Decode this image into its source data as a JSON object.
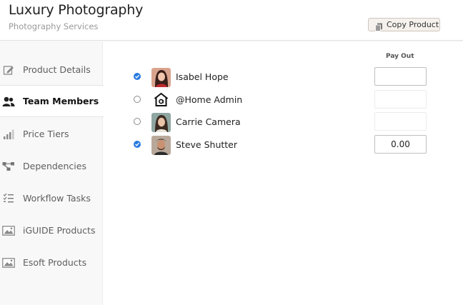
{
  "header": {
    "title": "Luxury Photography",
    "subtitle": "Photography Services",
    "copy_button": "Copy Product"
  },
  "sidebar": {
    "items": [
      {
        "label": "Product Details",
        "icon": "pencil-icon",
        "active": false
      },
      {
        "label": "Team Members",
        "icon": "users-icon",
        "active": true
      },
      {
        "label": "Price Tiers",
        "icon": "signal-bars-icon",
        "active": false
      },
      {
        "label": "Dependencies",
        "icon": "flow-icon",
        "active": false
      },
      {
        "label": "Workflow Tasks",
        "icon": "checklist-icon",
        "active": false
      },
      {
        "label": "iGUIDE Products",
        "icon": "image-icon",
        "active": false
      },
      {
        "label": "Esoft Products",
        "icon": "image-icon",
        "active": false
      }
    ]
  },
  "team": {
    "payout_header": "Pay Out",
    "members": [
      {
        "name": "Isabel Hope",
        "checked": true,
        "payout": "",
        "payout_enabled": true,
        "avatar": "photo-avatar"
      },
      {
        "name": "@Home Admin",
        "checked": false,
        "payout": "",
        "payout_enabled": false,
        "avatar": "home-logo-icon"
      },
      {
        "name": "Carrie Camera",
        "checked": false,
        "payout": "",
        "payout_enabled": false,
        "avatar": "photo-avatar"
      },
      {
        "name": "Steve Shutter",
        "checked": true,
        "payout": "0.00",
        "payout_enabled": true,
        "avatar": "photo-avatar"
      }
    ]
  },
  "colors": {
    "accent": "#2a7ae2",
    "sidebar_bg": "#f8f8f8",
    "copy_button_bg": "#f5f1ec"
  }
}
